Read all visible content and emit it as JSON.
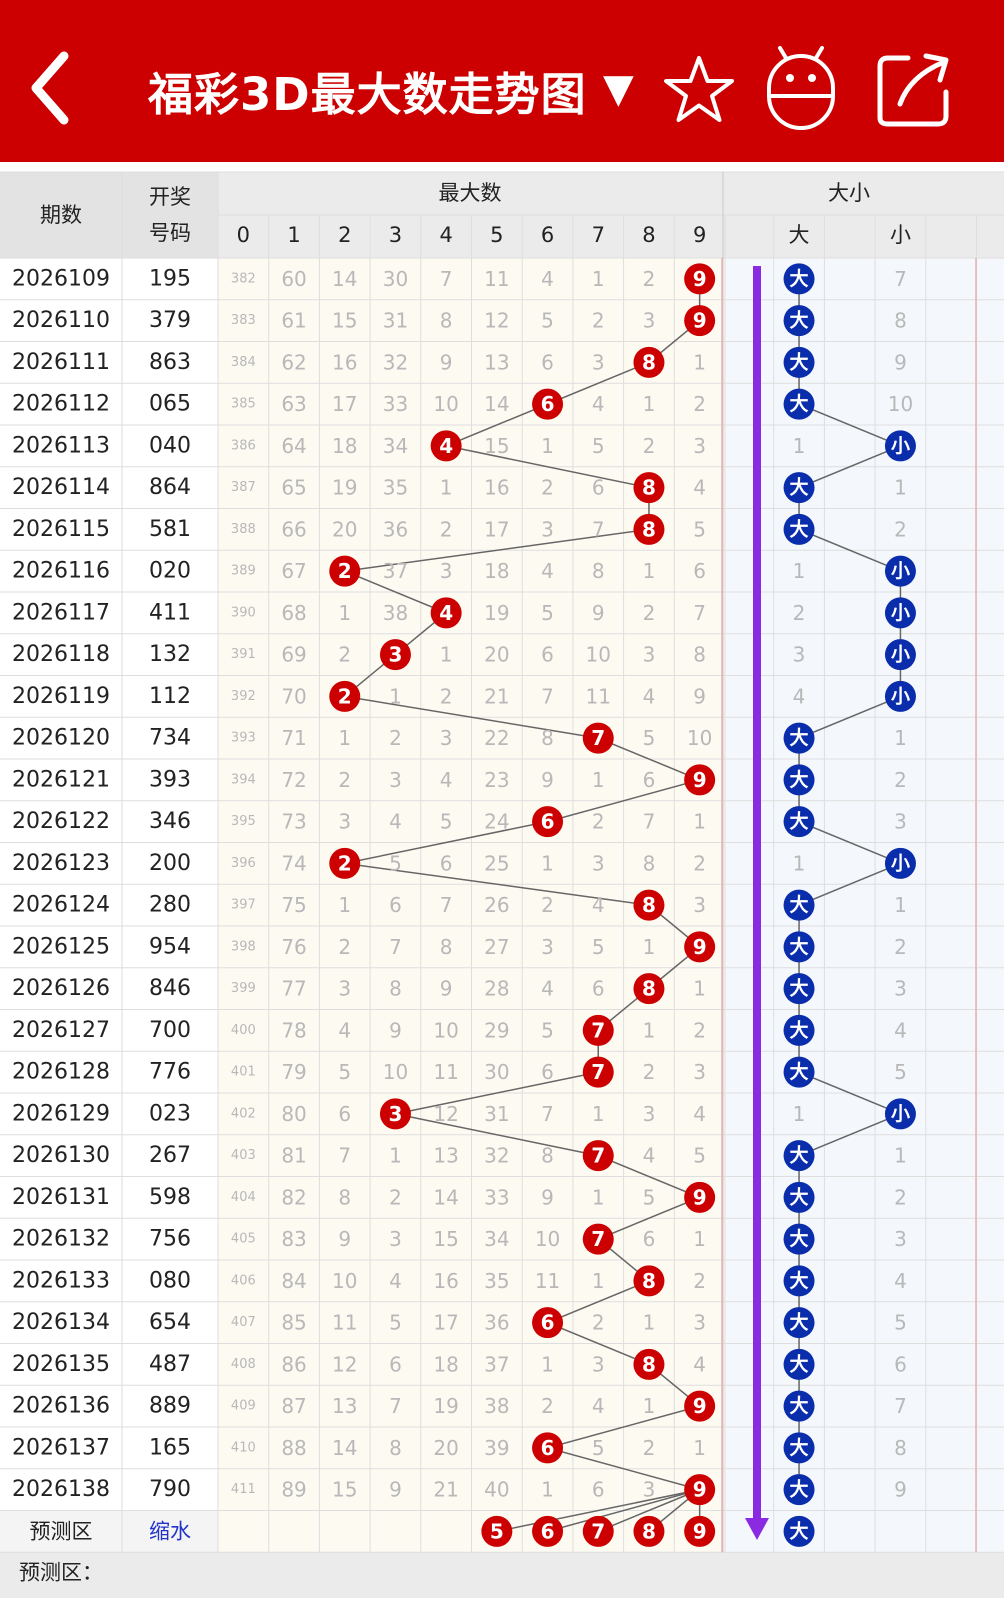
{
  "header": {
    "title": "福彩3D最大数走势图",
    "dropdown_icon": "triangle-down-icon",
    "icons": [
      "back-arrow-icon",
      "star-icon",
      "robot-icon",
      "share-icon"
    ]
  },
  "columns": {
    "issue_label": "期数",
    "draw_label_1": "开奖",
    "draw_label_2": "号码",
    "max_group_label": "最大数",
    "size_group_label": "大小",
    "digits": [
      "0",
      "1",
      "2",
      "3",
      "4",
      "5",
      "6",
      "7",
      "8",
      "9"
    ],
    "size_big": "大",
    "size_small": "小"
  },
  "colors": {
    "accent": "#cc0000",
    "ball_red": "#cc0000",
    "ball_blue": "#0a2dab",
    "arrow": "#8a2be2"
  },
  "rows": [
    {
      "issue": "2026109",
      "draw": "195",
      "miss": [
        "382",
        "60",
        "14",
        "30",
        "7",
        "11",
        "4",
        "1",
        "2",
        "9"
      ],
      "max": 9,
      "size": "大",
      "size_miss": [
        "大",
        "7"
      ]
    },
    {
      "issue": "2026110",
      "draw": "379",
      "miss": [
        "383",
        "61",
        "15",
        "31",
        "8",
        "12",
        "5",
        "2",
        "3",
        "9"
      ],
      "max": 9,
      "size": "大",
      "size_miss": [
        "大",
        "8"
      ]
    },
    {
      "issue": "2026111",
      "draw": "863",
      "miss": [
        "384",
        "62",
        "16",
        "32",
        "9",
        "13",
        "6",
        "3",
        "8",
        "1"
      ],
      "max": 8,
      "size": "大",
      "size_miss": [
        "大",
        "9"
      ]
    },
    {
      "issue": "2026112",
      "draw": "065",
      "miss": [
        "385",
        "63",
        "17",
        "33",
        "10",
        "14",
        "6",
        "4",
        "1",
        "2"
      ],
      "max": 6,
      "size": "大",
      "size_miss": [
        "大",
        "10"
      ]
    },
    {
      "issue": "2026113",
      "draw": "040",
      "miss": [
        "386",
        "64",
        "18",
        "34",
        "4",
        "15",
        "1",
        "5",
        "2",
        "3"
      ],
      "max": 4,
      "size": "小",
      "size_miss": [
        "1",
        "小"
      ]
    },
    {
      "issue": "2026114",
      "draw": "864",
      "miss": [
        "387",
        "65",
        "19",
        "35",
        "1",
        "16",
        "2",
        "6",
        "8",
        "4"
      ],
      "max": 8,
      "size": "大",
      "size_miss": [
        "大",
        "1"
      ]
    },
    {
      "issue": "2026115",
      "draw": "581",
      "miss": [
        "388",
        "66",
        "20",
        "36",
        "2",
        "17",
        "3",
        "7",
        "8",
        "5"
      ],
      "max": 8,
      "size": "大",
      "size_miss": [
        "大",
        "2"
      ]
    },
    {
      "issue": "2026116",
      "draw": "020",
      "miss": [
        "389",
        "67",
        "2",
        "37",
        "3",
        "18",
        "4",
        "8",
        "1",
        "6"
      ],
      "max": 2,
      "size": "小",
      "size_miss": [
        "1",
        "小"
      ]
    },
    {
      "issue": "2026117",
      "draw": "411",
      "miss": [
        "390",
        "68",
        "1",
        "38",
        "4",
        "19",
        "5",
        "9",
        "2",
        "7"
      ],
      "max": 4,
      "size": "小",
      "size_miss": [
        "2",
        "小"
      ]
    },
    {
      "issue": "2026118",
      "draw": "132",
      "miss": [
        "391",
        "69",
        "2",
        "3",
        "1",
        "20",
        "6",
        "10",
        "3",
        "8"
      ],
      "max": 3,
      "size": "小",
      "size_miss": [
        "3",
        "小"
      ]
    },
    {
      "issue": "2026119",
      "draw": "112",
      "miss": [
        "392",
        "70",
        "2",
        "1",
        "2",
        "21",
        "7",
        "11",
        "4",
        "9"
      ],
      "max": 2,
      "size": "小",
      "size_miss": [
        "4",
        "小"
      ]
    },
    {
      "issue": "2026120",
      "draw": "734",
      "miss": [
        "393",
        "71",
        "1",
        "2",
        "3",
        "22",
        "8",
        "7",
        "5",
        "10"
      ],
      "max": 7,
      "size": "大",
      "size_miss": [
        "大",
        "1"
      ]
    },
    {
      "issue": "2026121",
      "draw": "393",
      "miss": [
        "394",
        "72",
        "2",
        "3",
        "4",
        "23",
        "9",
        "1",
        "6",
        "9"
      ],
      "max": 9,
      "size": "大",
      "size_miss": [
        "大",
        "2"
      ]
    },
    {
      "issue": "2026122",
      "draw": "346",
      "miss": [
        "395",
        "73",
        "3",
        "4",
        "5",
        "24",
        "6",
        "2",
        "7",
        "1"
      ],
      "max": 6,
      "size": "大",
      "size_miss": [
        "大",
        "3"
      ]
    },
    {
      "issue": "2026123",
      "draw": "200",
      "miss": [
        "396",
        "74",
        "2",
        "5",
        "6",
        "25",
        "1",
        "3",
        "8",
        "2"
      ],
      "max": 2,
      "size": "小",
      "size_miss": [
        "1",
        "小"
      ]
    },
    {
      "issue": "2026124",
      "draw": "280",
      "miss": [
        "397",
        "75",
        "1",
        "6",
        "7",
        "26",
        "2",
        "4",
        "8",
        "3"
      ],
      "max": 8,
      "size": "大",
      "size_miss": [
        "大",
        "1"
      ]
    },
    {
      "issue": "2026125",
      "draw": "954",
      "miss": [
        "398",
        "76",
        "2",
        "7",
        "8",
        "27",
        "3",
        "5",
        "1",
        "9"
      ],
      "max": 9,
      "size": "大",
      "size_miss": [
        "大",
        "2"
      ]
    },
    {
      "issue": "2026126",
      "draw": "846",
      "miss": [
        "399",
        "77",
        "3",
        "8",
        "9",
        "28",
        "4",
        "6",
        "8",
        "1"
      ],
      "max": 8,
      "size": "大",
      "size_miss": [
        "大",
        "3"
      ]
    },
    {
      "issue": "2026127",
      "draw": "700",
      "miss": [
        "400",
        "78",
        "4",
        "9",
        "10",
        "29",
        "5",
        "7",
        "1",
        "2"
      ],
      "max": 7,
      "size": "大",
      "size_miss": [
        "大",
        "4"
      ]
    },
    {
      "issue": "2026128",
      "draw": "776",
      "miss": [
        "401",
        "79",
        "5",
        "10",
        "11",
        "30",
        "6",
        "7",
        "2",
        "3"
      ],
      "max": 7,
      "size": "大",
      "size_miss": [
        "大",
        "5"
      ]
    },
    {
      "issue": "2026129",
      "draw": "023",
      "miss": [
        "402",
        "80",
        "6",
        "3",
        "12",
        "31",
        "7",
        "1",
        "3",
        "4"
      ],
      "max": 3,
      "size": "小",
      "size_miss": [
        "1",
        "小"
      ]
    },
    {
      "issue": "2026130",
      "draw": "267",
      "miss": [
        "403",
        "81",
        "7",
        "1",
        "13",
        "32",
        "8",
        "7",
        "4",
        "5"
      ],
      "max": 7,
      "size": "大",
      "size_miss": [
        "大",
        "1"
      ]
    },
    {
      "issue": "2026131",
      "draw": "598",
      "miss": [
        "404",
        "82",
        "8",
        "2",
        "14",
        "33",
        "9",
        "1",
        "5",
        "9"
      ],
      "max": 9,
      "size": "大",
      "size_miss": [
        "大",
        "2"
      ]
    },
    {
      "issue": "2026132",
      "draw": "756",
      "miss": [
        "405",
        "83",
        "9",
        "3",
        "15",
        "34",
        "10",
        "7",
        "6",
        "1"
      ],
      "max": 7,
      "size": "大",
      "size_miss": [
        "大",
        "3"
      ]
    },
    {
      "issue": "2026133",
      "draw": "080",
      "miss": [
        "406",
        "84",
        "10",
        "4",
        "16",
        "35",
        "11",
        "1",
        "8",
        "2"
      ],
      "max": 8,
      "size": "大",
      "size_miss": [
        "大",
        "4"
      ]
    },
    {
      "issue": "2026134",
      "draw": "654",
      "miss": [
        "407",
        "85",
        "11",
        "5",
        "17",
        "36",
        "6",
        "2",
        "1",
        "3"
      ],
      "max": 6,
      "size": "大",
      "size_miss": [
        "大",
        "5"
      ]
    },
    {
      "issue": "2026135",
      "draw": "487",
      "miss": [
        "408",
        "86",
        "12",
        "6",
        "18",
        "37",
        "1",
        "3",
        "8",
        "4"
      ],
      "max": 8,
      "size": "大",
      "size_miss": [
        "大",
        "6"
      ]
    },
    {
      "issue": "2026136",
      "draw": "889",
      "miss": [
        "409",
        "87",
        "13",
        "7",
        "19",
        "38",
        "2",
        "4",
        "1",
        "9"
      ],
      "max": 9,
      "size": "大",
      "size_miss": [
        "大",
        "7"
      ]
    },
    {
      "issue": "2026137",
      "draw": "165",
      "miss": [
        "410",
        "88",
        "14",
        "8",
        "20",
        "39",
        "6",
        "5",
        "2",
        "1"
      ],
      "max": 6,
      "size": "大",
      "size_miss": [
        "大",
        "8"
      ]
    },
    {
      "issue": "2026138",
      "draw": "790",
      "miss": [
        "411",
        "89",
        "15",
        "9",
        "21",
        "40",
        "1",
        "6",
        "3",
        "9"
      ],
      "max": 9,
      "size": "大",
      "size_miss": [
        "大",
        "9"
      ]
    }
  ],
  "forecast": {
    "label": "预测区",
    "link": "缩水",
    "balls": [
      "5",
      "6",
      "7",
      "8",
      "9"
    ],
    "size": "大",
    "next_label": "预测区："
  }
}
